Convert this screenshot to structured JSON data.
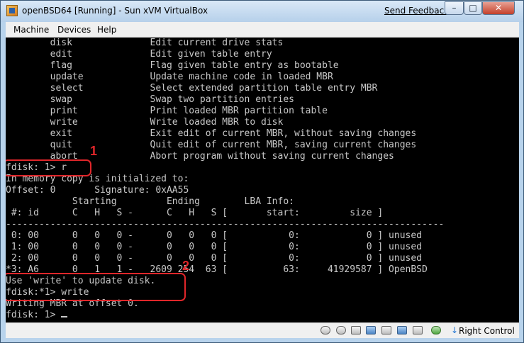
{
  "window": {
    "title": "openBSD64 [Running] - Sun xVM VirtualBox",
    "send_feedback": "Send Feedback",
    "minimize_glyph": "–",
    "maximize_glyph": "□",
    "close_glyph": "✕"
  },
  "menu": {
    "items": [
      "Machine",
      "Devices",
      "Help"
    ]
  },
  "terminal": {
    "lines": [
      "        disk              Edit current drive stats",
      "        edit              Edit given table entry",
      "        flag              Flag given table entry as bootable",
      "        update            Update machine code in loaded MBR",
      "        select            Select extended partition table entry MBR",
      "        swap              Swap two partition entries",
      "        print             Print loaded MBR partition table",
      "        write             Write loaded MBR to disk",
      "        exit              Exit edit of current MBR, without saving changes",
      "        quit              Quit edit of current MBR, saving current changes",
      "        abort             Abort program without saving current changes",
      "fdisk: 1> r",
      "In memory copy is initialized to:",
      "Offset: 0       Signature: 0xAA55",
      "            Starting         Ending        LBA Info:",
      " #: id      C   H   S -      C   H   S [       start:         size ]",
      "-------------------------------------------------------------------------------",
      " 0: 00      0   0   0 -      0   0   0 [           0:            0 ] unused",
      " 1: 00      0   0   0 -      0   0   0 [           0:            0 ] unused",
      " 2: 00      0   0   0 -      0   0   0 [           0:            0 ] unused",
      "*3: A6      0   1   1 -   2609 254  63 [          63:     41929587 ] OpenBSD",
      "Use 'write' to update disk.",
      "fdisk:*1> write",
      "Writing MBR at offset 0.",
      "fdisk: 1> "
    ]
  },
  "annotations": {
    "step1": "1",
    "step2": "2"
  },
  "statusbar": {
    "icons": [
      "hard-disk-icon",
      "cdrom-icon",
      "floppy-icon",
      "usb-icon",
      "network-icon",
      "shared-folder-icon",
      "display-icon",
      "mouse-integration-icon"
    ],
    "host_key_arrow": "↓",
    "host_key": "Right Control"
  }
}
